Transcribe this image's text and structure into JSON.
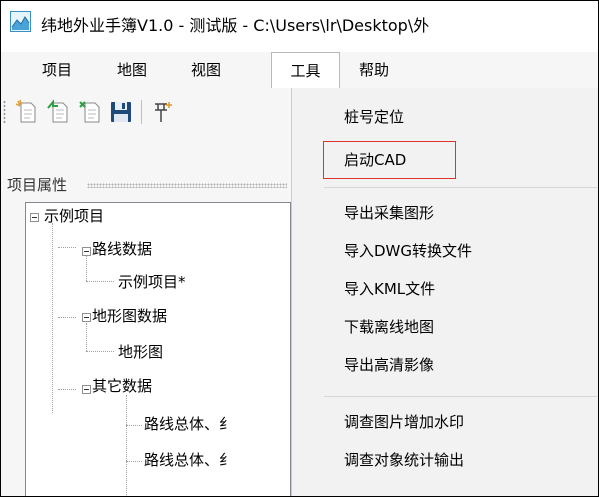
{
  "window": {
    "title": "纬地外业手簿V1.0 - 测试版 - C:\\Users\\lr\\Desktop\\外"
  },
  "menubar": {
    "items": [
      {
        "label": "项目"
      },
      {
        "label": "地图"
      },
      {
        "label": "视图"
      },
      {
        "label": "工具"
      },
      {
        "label": "帮助"
      }
    ]
  },
  "toolbar": {
    "buttons": [
      "new-project-icon",
      "open-project-icon",
      "close-project-icon",
      "save-icon",
      "pin-add-icon"
    ]
  },
  "panel": {
    "title": "项目属性"
  },
  "tree": {
    "root": "示例项目",
    "route_group": "路线数据",
    "route_item": "示例项目*",
    "terrain_group": "地形图数据",
    "terrain_item": "地形图",
    "other_group": "其它数据",
    "other_item_1": "路线总体、纟",
    "other_item_2": "路线总体、纟"
  },
  "tools_menu": {
    "items": [
      "桩号定位",
      "启动CAD",
      "导出采集图形",
      "导入DWG转换文件",
      "导入KML文件",
      "下载离线地图",
      "导出高清影像",
      "调查图片增加水印",
      "调查对象统计输出"
    ],
    "highlight_color": "#e0332e"
  }
}
